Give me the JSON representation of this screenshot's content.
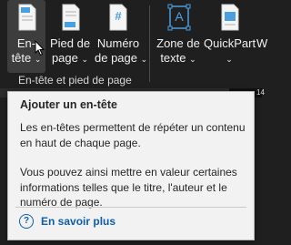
{
  "ribbon": {
    "buttons": [
      {
        "line1": "En-",
        "line2": "tête",
        "chev": "⌄"
      },
      {
        "line1": "Pied de",
        "line2": "page",
        "chev": "⌄"
      },
      {
        "line1": "Numéro",
        "line2": "de page",
        "chev": "⌄"
      },
      {
        "line1": "Zone de",
        "line2": "texte",
        "chev": "⌄"
      },
      {
        "line1": "QuickPart",
        "line2": "",
        "chev": "⌄"
      }
    ],
    "group_label": "En-tête et pied de page",
    "page_number_glyph": "#",
    "textbox_glyph": "A",
    "partial_right_label": "W",
    "ruler_text": "14"
  },
  "tooltip": {
    "title": "Ajouter un en-tête",
    "paragraph1": "Les en-têtes permettent de répéter un contenu en haut de chaque page.",
    "paragraph2": "Vous pouvez ainsi mettre en valeur certaines informations telles que le titre, l'auteur et le numéro de page.",
    "help_icon": "?",
    "help_link": "En savoir plus"
  },
  "colors": {
    "ribbon_bg": "#1f1f1f",
    "tooltip_bg": "#f2f2f2",
    "link": "#0f5ea8",
    "icon_accent": "#4a9fe0"
  }
}
